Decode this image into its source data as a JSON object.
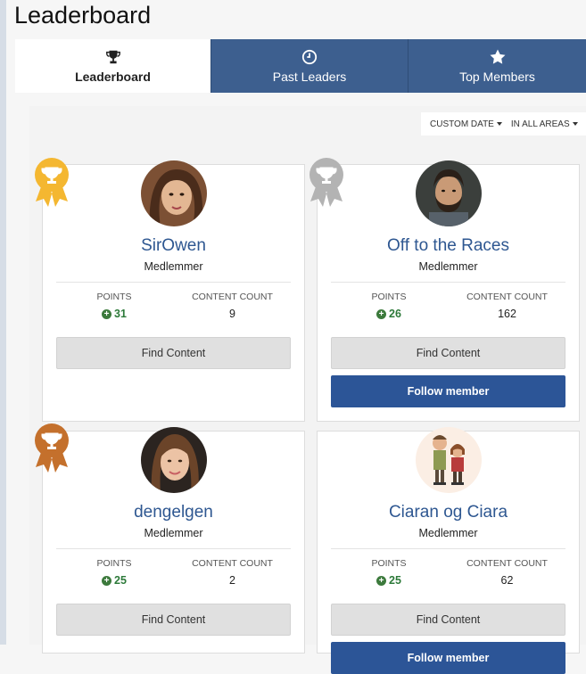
{
  "page": {
    "title": "Leaderboard"
  },
  "tabs": [
    {
      "label": "Leaderboard",
      "icon": "trophy-icon",
      "active": true
    },
    {
      "label": "Past Leaders",
      "icon": "clock-icon",
      "active": false
    },
    {
      "label": "Top Members",
      "icon": "star-icon",
      "active": false
    }
  ],
  "filters": {
    "date_label": "CUSTOM DATE",
    "area_label": "IN ALL AREAS"
  },
  "stats_labels": {
    "points": "POINTS",
    "content_count": "CONTENT COUNT"
  },
  "buttons": {
    "find_content": "Find Content",
    "follow_member": "Follow member"
  },
  "colors": {
    "tab_blue": "#3d5f8f",
    "link_blue": "#2e5791",
    "points_green": "#2d7a3a",
    "gold": "#f4b731",
    "silver": "#b3b3b3",
    "bronze": "#c4702c",
    "follow_blue": "#2c5597"
  },
  "members": [
    {
      "name": "SirOwen",
      "group": "Medlemmer",
      "points": "31",
      "content_count": "9",
      "rank": "gold"
    },
    {
      "name": "Off to the Races",
      "group": "Medlemmer",
      "points": "26",
      "content_count": "162",
      "rank": "silver"
    },
    {
      "name": "dengelgen",
      "group": "Medlemmer",
      "points": "25",
      "content_count": "2",
      "rank": "bronze"
    },
    {
      "name": "Ciaran og Ciara",
      "group": "Medlemmer",
      "points": "25",
      "content_count": "62",
      "rank": "none"
    }
  ]
}
